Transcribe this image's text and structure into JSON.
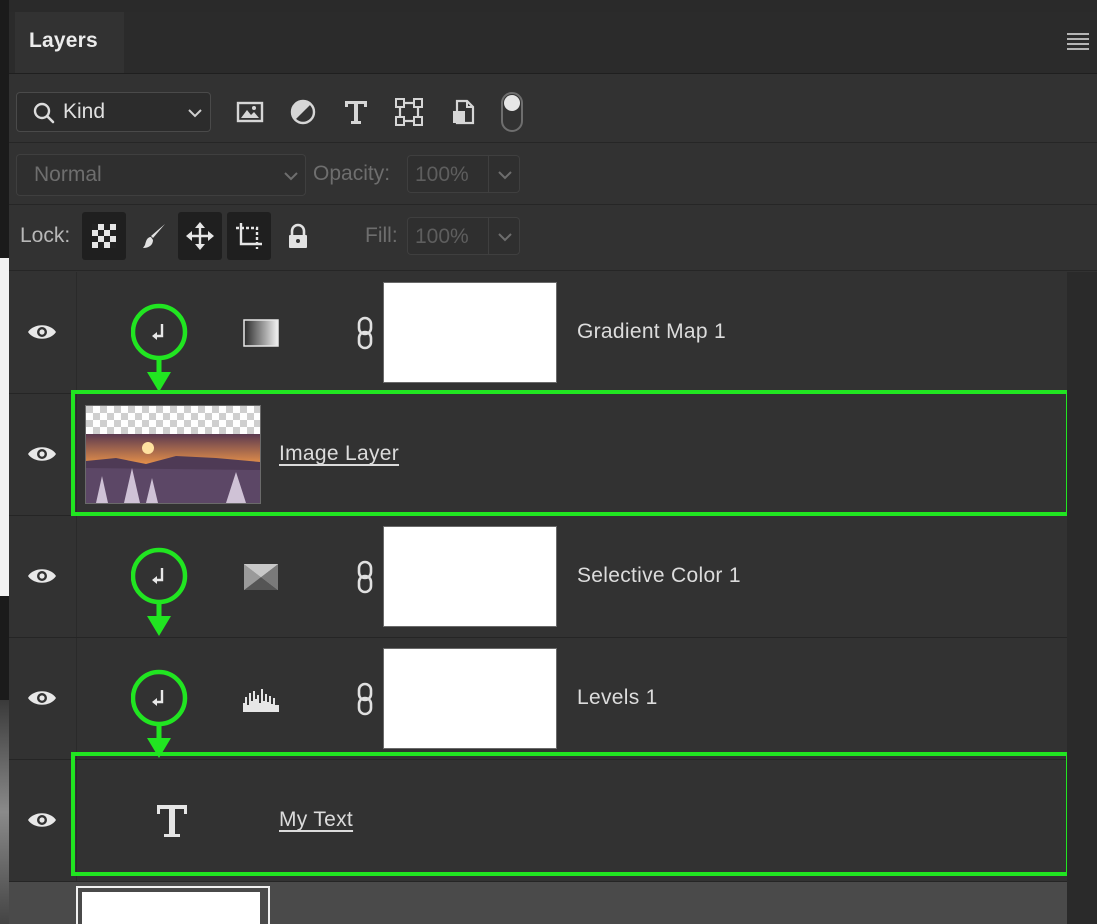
{
  "panel": {
    "tab_label": "Layers",
    "menu_icon": "panel-menu-icon"
  },
  "filter": {
    "kind_label": "Kind",
    "filter_icons": [
      "pixel-layer-filter-icon",
      "adjustment-filter-icon",
      "type-filter-icon",
      "shape-filter-icon",
      "smart-object-filter-icon"
    ],
    "toggle_state": "on"
  },
  "blend": {
    "mode": "Normal",
    "opacity_label": "Opacity:",
    "opacity_value": "100%"
  },
  "lock": {
    "label": "Lock:",
    "icons": [
      "lock-transparent-icon",
      "lock-image-icon",
      "lock-position-icon",
      "lock-artboard-icon",
      "lock-all-icon"
    ],
    "fill_label": "Fill:",
    "fill_value": "100%"
  },
  "layers": [
    {
      "name": "Gradient Map 1",
      "type": "adjustment",
      "icon": "gradient-map-icon",
      "clipped": true,
      "highlighted": false
    },
    {
      "name": "Image Layer",
      "type": "pixel",
      "icon": "image-thumbnail",
      "clipped": false,
      "highlighted": true
    },
    {
      "name": "Selective Color 1",
      "type": "adjustment",
      "icon": "selective-color-icon",
      "clipped": true,
      "highlighted": false
    },
    {
      "name": "Levels 1",
      "type": "adjustment",
      "icon": "levels-icon",
      "clipped": true,
      "highlighted": false
    },
    {
      "name": "My Text",
      "type": "text",
      "icon": "type-layer-icon",
      "clipped": false,
      "highlighted": true
    }
  ],
  "colors": {
    "highlight": "#21e521",
    "panel_bg": "#323232"
  }
}
